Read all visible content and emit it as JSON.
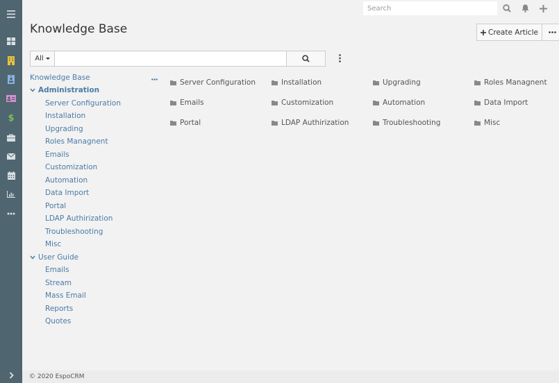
{
  "navbar": {
    "items": [
      {
        "name": "menu",
        "icon": "hamburger-icon"
      },
      {
        "name": "dashboard",
        "icon": "dashboard-grid-icon"
      },
      {
        "name": "accounts",
        "icon": "building-icon",
        "color": "#e9c23c"
      },
      {
        "name": "contacts",
        "icon": "id-badge-icon",
        "color": "#8ab4e0"
      },
      {
        "name": "leads",
        "icon": "id-card-icon",
        "color": "#d68fcf"
      },
      {
        "name": "opportunities",
        "icon": "dollar-icon",
        "color": "#7bbf57"
      },
      {
        "name": "cases",
        "icon": "briefcase-icon"
      },
      {
        "name": "emails",
        "icon": "envelope-icon"
      },
      {
        "name": "calendar",
        "icon": "calendar-icon"
      },
      {
        "name": "reports",
        "icon": "bar-chart-icon"
      },
      {
        "name": "more",
        "icon": "ellipsis-icon"
      }
    ],
    "expand_icon": "chevron-right-icon"
  },
  "topbar": {
    "search_placeholder": "Search",
    "icons": [
      "search-icon",
      "bell-icon",
      "plus-icon"
    ]
  },
  "header": {
    "title": "Knowledge Base",
    "create_label": "Create Article",
    "more_icon": "ellipsis-icon"
  },
  "search": {
    "filter_label": "All",
    "text_value": "",
    "text_placeholder": ""
  },
  "tree": {
    "root": "Knowledge Base",
    "groups": [
      {
        "label": "Administration",
        "bold": true,
        "expanded": true,
        "children": [
          "Server Configuration",
          "Installation",
          "Upgrading",
          "Roles Managnent",
          "Emails",
          "Customization",
          "Automation",
          "Data Import",
          "Portal",
          "LDAP Authirization",
          "Troubleshooting",
          "Misc"
        ]
      },
      {
        "label": "User Guide",
        "bold": false,
        "expanded": true,
        "children": [
          "Emails",
          "Stream",
          "Mass Email",
          "Reports",
          "Quotes"
        ]
      }
    ]
  },
  "categories": [
    "Server Configuration",
    "Installation",
    "Upgrading",
    "Roles Managnent",
    "Emails",
    "Customization",
    "Automation",
    "Data Import",
    "Portal",
    "LDAP Authirization",
    "Troubleshooting",
    "Misc"
  ],
  "footer": {
    "text": "© 2020 EspoCRM"
  },
  "colors": {
    "nav_bg": "#4f6570",
    "link": "#4a7ba6",
    "page_bg": "#f2f2f2"
  }
}
